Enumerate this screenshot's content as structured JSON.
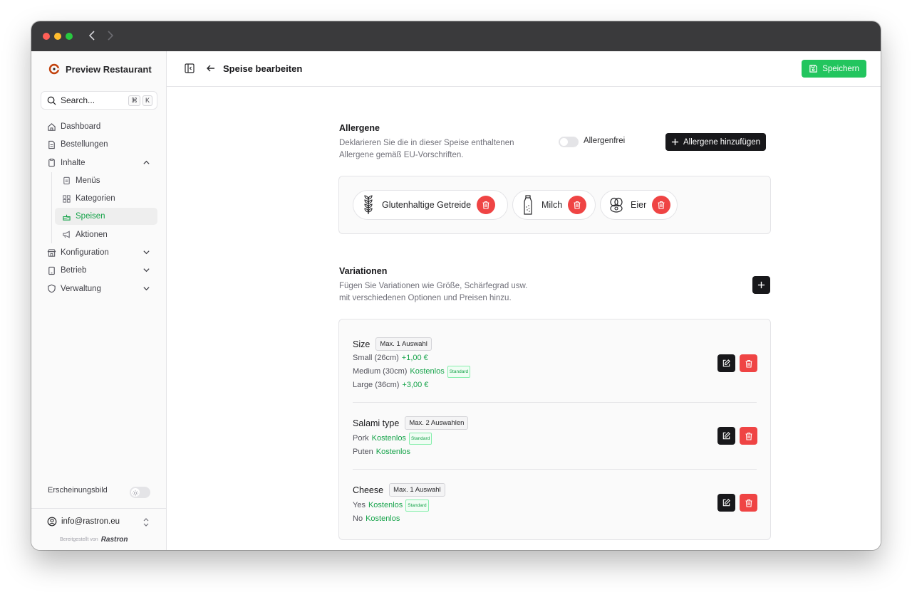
{
  "brand": {
    "name": "Preview Restaurant"
  },
  "search": {
    "label": "Search...",
    "kbd1": "⌘",
    "kbd2": "K"
  },
  "sidebar": {
    "items": [
      {
        "label": "Dashboard"
      },
      {
        "label": "Bestellungen"
      },
      {
        "label": "Inhalte"
      },
      {
        "label": "Menüs"
      },
      {
        "label": "Kategorien"
      },
      {
        "label": "Speisen"
      },
      {
        "label": "Aktionen"
      },
      {
        "label": "Konfiguration"
      },
      {
        "label": "Betrieb"
      },
      {
        "label": "Verwaltung"
      }
    ],
    "appearance_label": "Erscheinungsbild",
    "account_email": "info@rastron.eu",
    "powered_by": "Bereitgestellt von",
    "powered_brand": "Rastron"
  },
  "header": {
    "title": "Speise bearbeiten",
    "save_label": "Speichern"
  },
  "allergens": {
    "title": "Allergene",
    "desc_line1": "Deklarieren Sie die in dieser Speise enthaltenen",
    "desc_line2": "Allergene gemäß EU-Vorschriften.",
    "free_label": "Allergenfrei",
    "add_label": "Allergene hinzufügen",
    "items": [
      {
        "label": "Glutenhaltige Getreide"
      },
      {
        "label": "Milch"
      },
      {
        "label": "Eier"
      }
    ]
  },
  "variations": {
    "title": "Variationen",
    "desc_line1": "Fügen Sie Variationen wie Größe, Schärfegrad usw.",
    "desc_line2": "mit verschiedenen Optionen und Preisen hinzu.",
    "groups": [
      {
        "name": "Size",
        "max": "Max. 1 Auswahl",
        "options": [
          {
            "label": "Small (26cm)",
            "price": "+1,00 €",
            "standard": ""
          },
          {
            "label": "Medium (30cm)",
            "price": "Kostenlos",
            "standard": "Standard"
          },
          {
            "label": "Large (36cm)",
            "price": "+3,00 €",
            "standard": ""
          }
        ]
      },
      {
        "name": "Salami type",
        "max": "Max. 2 Auswahlen",
        "options": [
          {
            "label": "Pork",
            "price": "Kostenlos",
            "standard": "Standard"
          },
          {
            "label": "Puten",
            "price": "Kostenlos",
            "standard": ""
          }
        ]
      },
      {
        "name": "Cheese",
        "max": "Max. 1 Auswahl",
        "options": [
          {
            "label": "Yes",
            "price": "Kostenlos",
            "standard": "Standard"
          },
          {
            "label": "No",
            "price": "Kostenlos",
            "standard": ""
          }
        ]
      }
    ]
  },
  "colors": {
    "accent": "#22c55e",
    "danger": "#ef4444",
    "dark": "#18181b"
  }
}
